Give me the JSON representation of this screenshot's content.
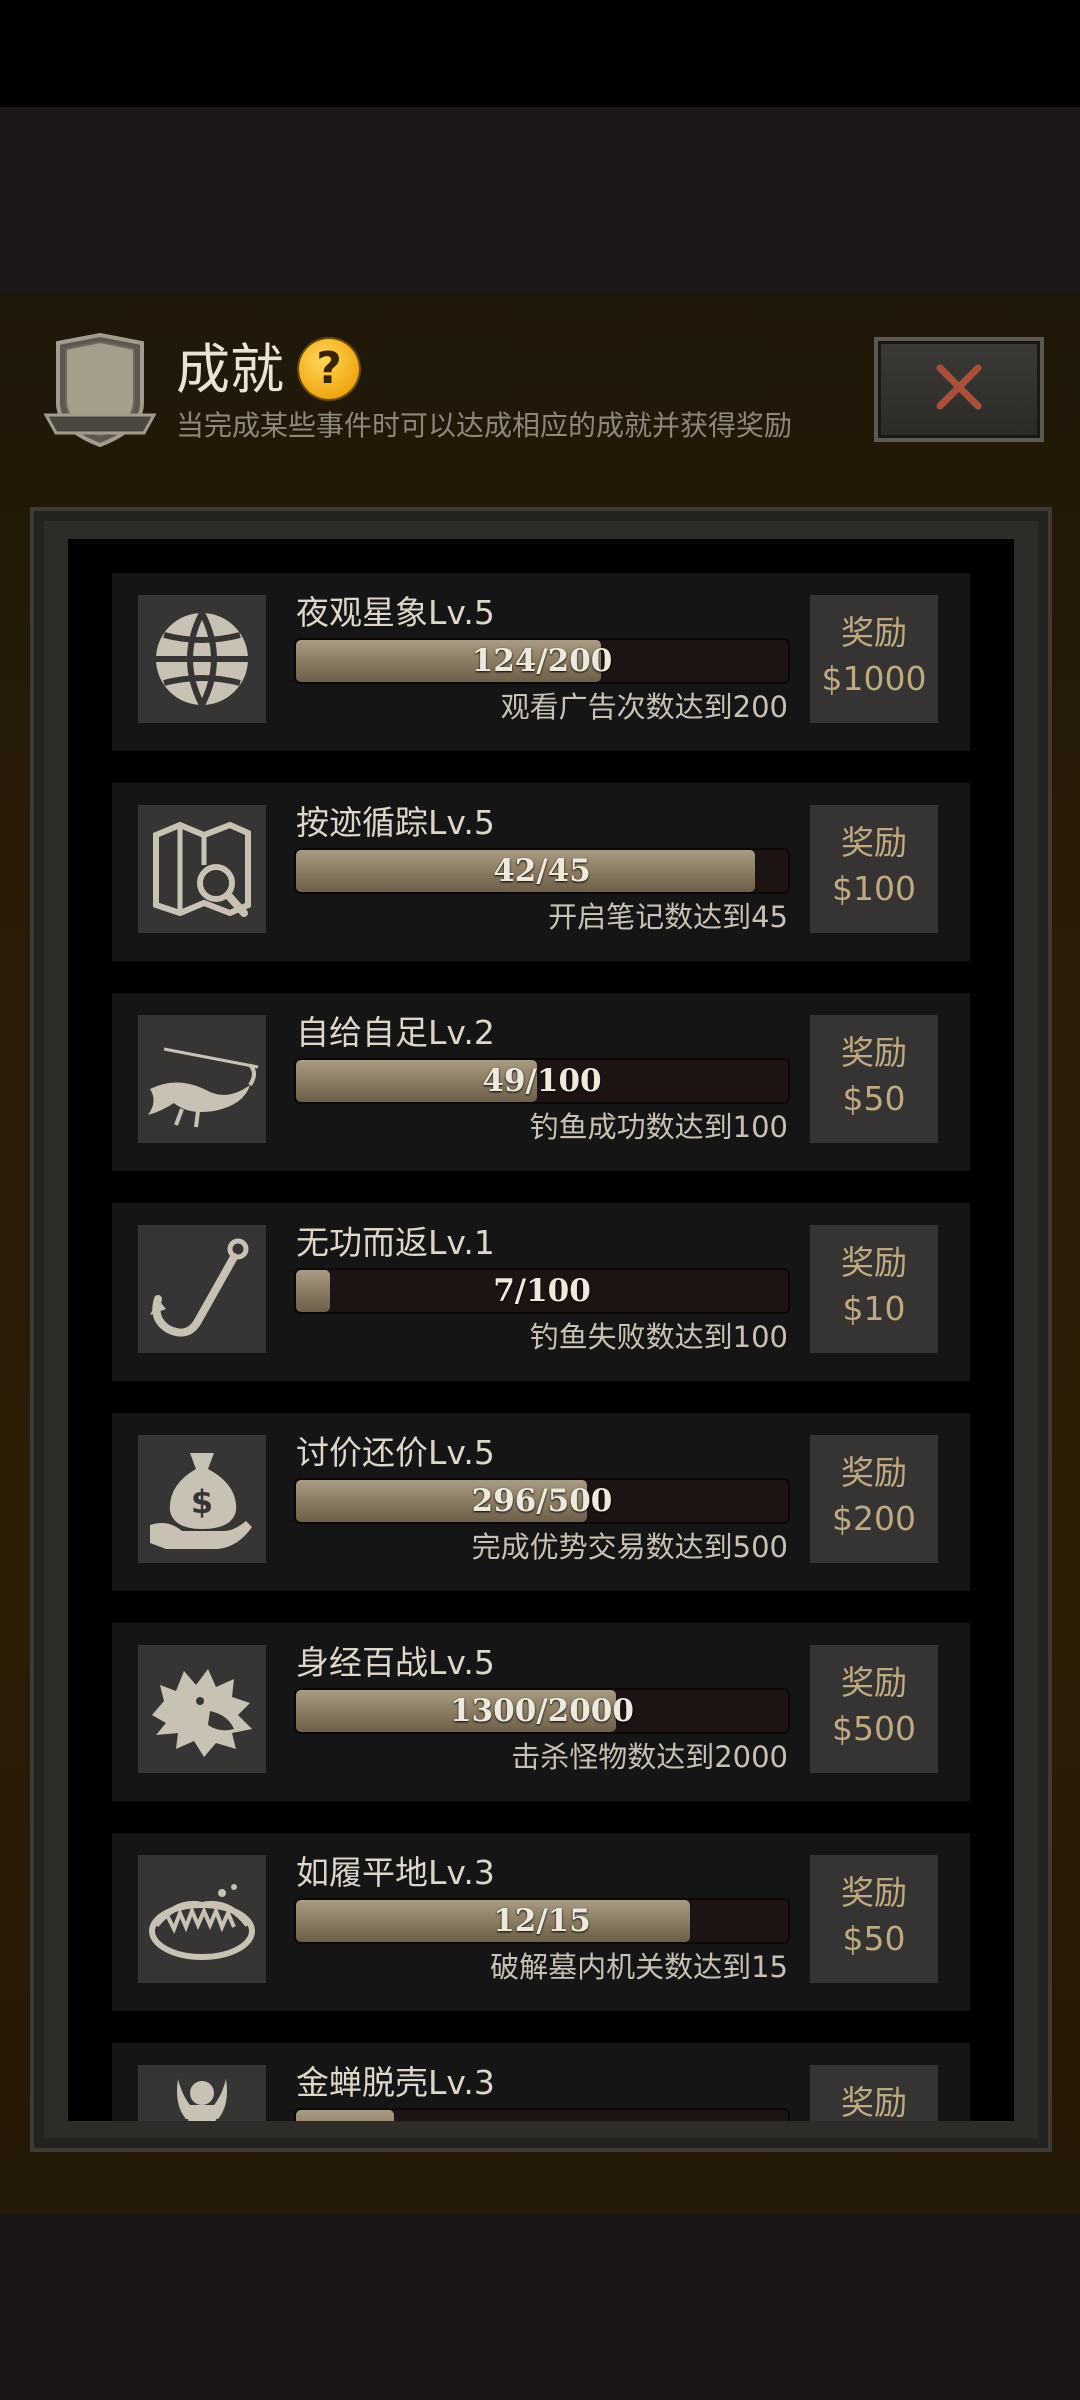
{
  "header": {
    "title": "成就",
    "help_icon": "?",
    "subtitle": "当完成某些事件时可以达成相应的成就并获得奖励",
    "close_icon": "close-x-icon"
  },
  "achievements": [
    {
      "name": "夜观星象Lv.5",
      "progress_text": "124/200",
      "progress": 0.62,
      "goal": "观看广告次数达到200",
      "reward_label": "奖励",
      "reward_amount": "$1000",
      "icon": "globe-icon"
    },
    {
      "name": "按迹循踪Lv.5",
      "progress_text": "42/45",
      "progress": 0.933,
      "goal": "开启笔记数达到45",
      "reward_label": "奖励",
      "reward_amount": "$100",
      "icon": "map-search-icon"
    },
    {
      "name": "自给自足Lv.2",
      "progress_text": "49/100",
      "progress": 0.49,
      "goal": "钓鱼成功数达到100",
      "reward_label": "奖励",
      "reward_amount": "$50",
      "icon": "fish-hooked-icon"
    },
    {
      "name": "无功而返Lv.1",
      "progress_text": "7/100",
      "progress": 0.07,
      "goal": "钓鱼失败数达到100",
      "reward_label": "奖励",
      "reward_amount": "$10",
      "icon": "fishhook-icon"
    },
    {
      "name": "讨价还价Lv.5",
      "progress_text": "296/500",
      "progress": 0.592,
      "goal": "完成优势交易数达到500",
      "reward_label": "奖励",
      "reward_amount": "$200",
      "icon": "money-bag-hand-icon"
    },
    {
      "name": "身经百战Lv.5",
      "progress_text": "1300/2000",
      "progress": 0.65,
      "goal": "击杀怪物数达到2000",
      "reward_label": "奖励",
      "reward_amount": "$500",
      "icon": "wolf-head-icon"
    },
    {
      "name": "如履平地Lv.3",
      "progress_text": "12/15",
      "progress": 0.8,
      "goal": "破解墓内机关数达到15",
      "reward_label": "奖励",
      "reward_amount": "$50",
      "icon": "bear-trap-icon"
    },
    {
      "name": "金蝉脱壳Lv.3",
      "progress_text": "",
      "progress": 0.2,
      "goal": "",
      "reward_label": "奖励",
      "reward_amount": "",
      "icon": "escape-figure-icon"
    }
  ]
}
